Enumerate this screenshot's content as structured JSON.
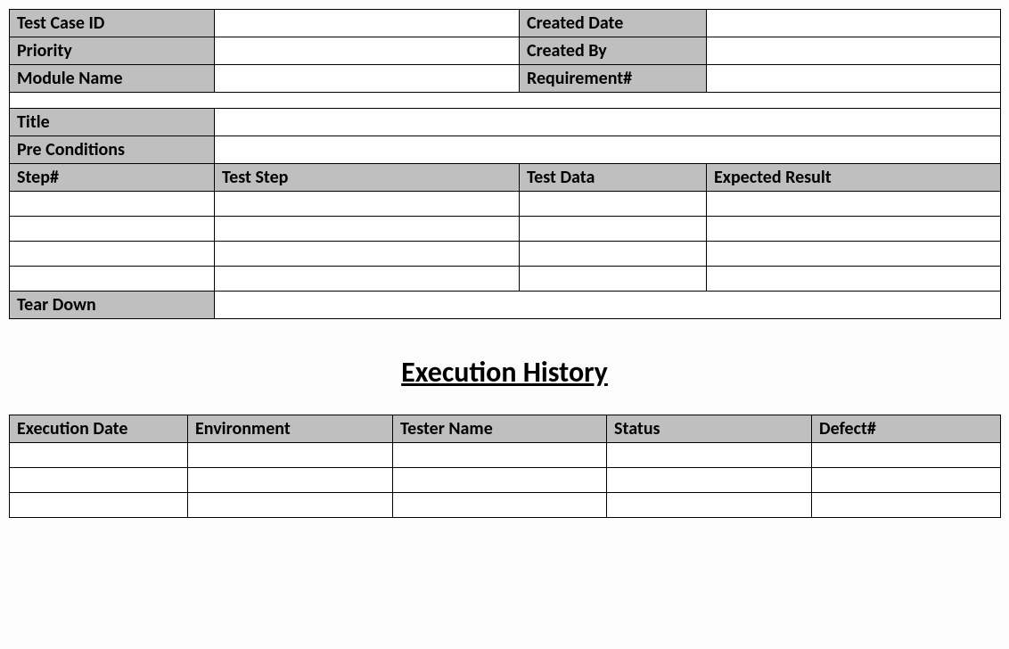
{
  "meta": {
    "test_case_id_label": "Test Case ID",
    "test_case_id_value": "",
    "created_date_label": "Created Date",
    "created_date_value": "",
    "priority_label": "Priority",
    "priority_value": "",
    "created_by_label": "Created By",
    "created_by_value": "",
    "module_name_label": "Module Name",
    "module_name_value": "",
    "requirement_label": "Requirement#",
    "requirement_value": ""
  },
  "detail": {
    "title_label": "Title",
    "title_value": "",
    "preconditions_label": "Pre Conditions",
    "preconditions_value": "",
    "teardown_label": "Tear Down",
    "teardown_value": ""
  },
  "steps_header": {
    "step_num": "Step#",
    "test_step": "Test Step",
    "test_data": "Test Data",
    "expected": "Expected Result"
  },
  "steps": [
    {
      "num": "",
      "step": "",
      "data": "",
      "expected": ""
    },
    {
      "num": "",
      "step": "",
      "data": "",
      "expected": ""
    },
    {
      "num": "",
      "step": "",
      "data": "",
      "expected": ""
    },
    {
      "num": "",
      "step": "",
      "data": "",
      "expected": ""
    }
  ],
  "history_title": "Execution History",
  "history_header": {
    "exec_date": "Execution Date",
    "environment": "Environment",
    "tester": "Tester Name",
    "status": "Status",
    "defect": "Defect#"
  },
  "history": [
    {
      "date": "",
      "env": "",
      "tester": "",
      "status": "",
      "defect": ""
    },
    {
      "date": "",
      "env": "",
      "tester": "",
      "status": "",
      "defect": ""
    },
    {
      "date": "",
      "env": "",
      "tester": "",
      "status": "",
      "defect": ""
    }
  ]
}
